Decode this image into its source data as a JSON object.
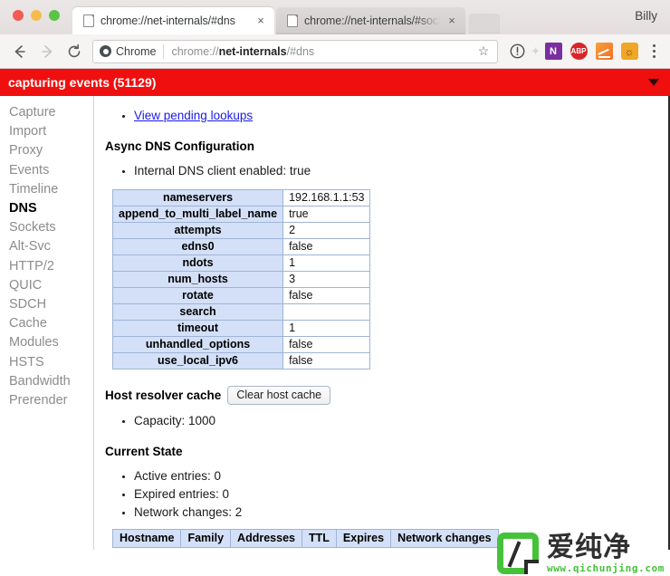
{
  "window": {
    "profile_name": "Billy",
    "traffic_lights": [
      "close",
      "minimize",
      "zoom"
    ]
  },
  "tabs": [
    {
      "title": "chrome://net-internals/#dns",
      "active": true,
      "close_label": "×",
      "icon": "page-icon"
    },
    {
      "title": "chrome://net-internals/#socke",
      "active": false,
      "close_label": "×",
      "icon": "page-icon"
    }
  ],
  "toolbar": {
    "back_label": "←",
    "forward_label": "→",
    "reload_label": "⟳",
    "security_chip": "Chrome",
    "url_prefix": "chrome://",
    "url_strong": "net-internals",
    "url_suffix": "/#dns",
    "star_label": "☆",
    "extensions": [
      {
        "name": "onenote-extension",
        "glyph": "N"
      },
      {
        "name": "adblock-plus-extension",
        "glyph": "ABP"
      },
      {
        "name": "chart-extension",
        "glyph": ""
      },
      {
        "name": "pumpkin-extension",
        "glyph": "⌢"
      }
    ],
    "menu_label": "⋮"
  },
  "capture_bar": {
    "text": "capturing events (51129)",
    "color": "#ef0f0f",
    "caret": "▼"
  },
  "sidebar": {
    "items": [
      {
        "label": "Capture",
        "active": false
      },
      {
        "label": "Import",
        "active": false
      },
      {
        "label": "Proxy",
        "active": false
      },
      {
        "label": "Events",
        "active": false
      },
      {
        "label": "Timeline",
        "active": false
      },
      {
        "label": "DNS",
        "active": true
      },
      {
        "label": "Sockets",
        "active": false
      },
      {
        "label": "Alt-Svc",
        "active": false
      },
      {
        "label": "HTTP/2",
        "active": false
      },
      {
        "label": "QUIC",
        "active": false
      },
      {
        "label": "SDCH",
        "active": false
      },
      {
        "label": "Cache",
        "active": false
      },
      {
        "label": "Modules",
        "active": false
      },
      {
        "label": "HSTS",
        "active": false
      },
      {
        "label": "Bandwidth",
        "active": false
      },
      {
        "label": "Prerender",
        "active": false
      }
    ]
  },
  "content": {
    "pending_lookups_link": "View pending lookups",
    "async_dns_heading": "Async DNS Configuration",
    "internal_dns_client": "Internal DNS client enabled: true",
    "config_table": {
      "rows": [
        {
          "key": "nameservers",
          "value": "192.168.1.1:53"
        },
        {
          "key": "append_to_multi_label_name",
          "value": "true"
        },
        {
          "key": "attempts",
          "value": "2"
        },
        {
          "key": "edns0",
          "value": "false"
        },
        {
          "key": "ndots",
          "value": "1"
        },
        {
          "key": "num_hosts",
          "value": "3"
        },
        {
          "key": "rotate",
          "value": "false"
        },
        {
          "key": "search",
          "value": ""
        },
        {
          "key": "timeout",
          "value": "1"
        },
        {
          "key": "unhandled_options",
          "value": "false"
        },
        {
          "key": "use_local_ipv6",
          "value": "false"
        }
      ]
    },
    "host_resolver_heading": "Host resolver cache",
    "clear_host_cache_button": "Clear host cache",
    "capacity": "Capacity: 1000",
    "current_state_heading": "Current State",
    "current_state": [
      "Active entries: 0",
      "Expired entries: 0",
      "Network changes: 2"
    ],
    "cache_table_headers": [
      "Hostname",
      "Family",
      "Addresses",
      "TTL",
      "Expires",
      "Network changes"
    ]
  },
  "watermark": {
    "chinese": "爱纯净",
    "url": "www.qichunjing.com",
    "brand_color": "#46c23a"
  }
}
